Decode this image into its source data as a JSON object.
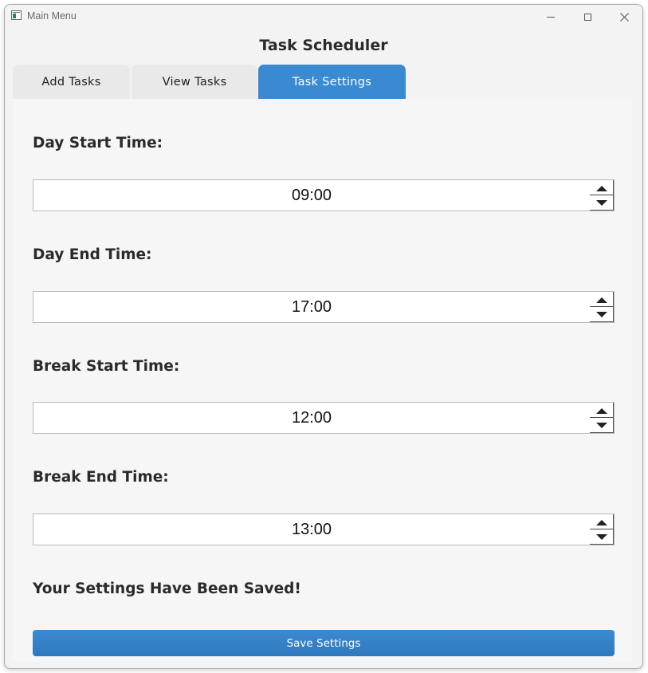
{
  "window": {
    "title": "Main Menu"
  },
  "app": {
    "heading": "Task Scheduler"
  },
  "tabs": [
    {
      "label": "Add Tasks",
      "active": false
    },
    {
      "label": "View Tasks",
      "active": false
    },
    {
      "label": "Task Settings",
      "active": true
    }
  ],
  "settings": {
    "day_start": {
      "label": "Day Start Time:",
      "value": "09:00"
    },
    "day_end": {
      "label": "Day End Time:",
      "value": "17:00"
    },
    "break_start": {
      "label": "Break Start Time:",
      "value": "12:00"
    },
    "break_end": {
      "label": "Break End Time:",
      "value": "13:00"
    }
  },
  "status_message": "Your Settings Have Been Saved!",
  "save_button_label": "Save Settings",
  "colors": {
    "accent": "#3a8ad2",
    "background": "#f3f3f3",
    "text": "#2a2a2a"
  },
  "icons": {
    "minimize": "minimize-icon",
    "maximize": "maximize-icon",
    "close": "close-icon",
    "spin_up": "triangle-up-icon",
    "spin_down": "triangle-down-icon"
  }
}
